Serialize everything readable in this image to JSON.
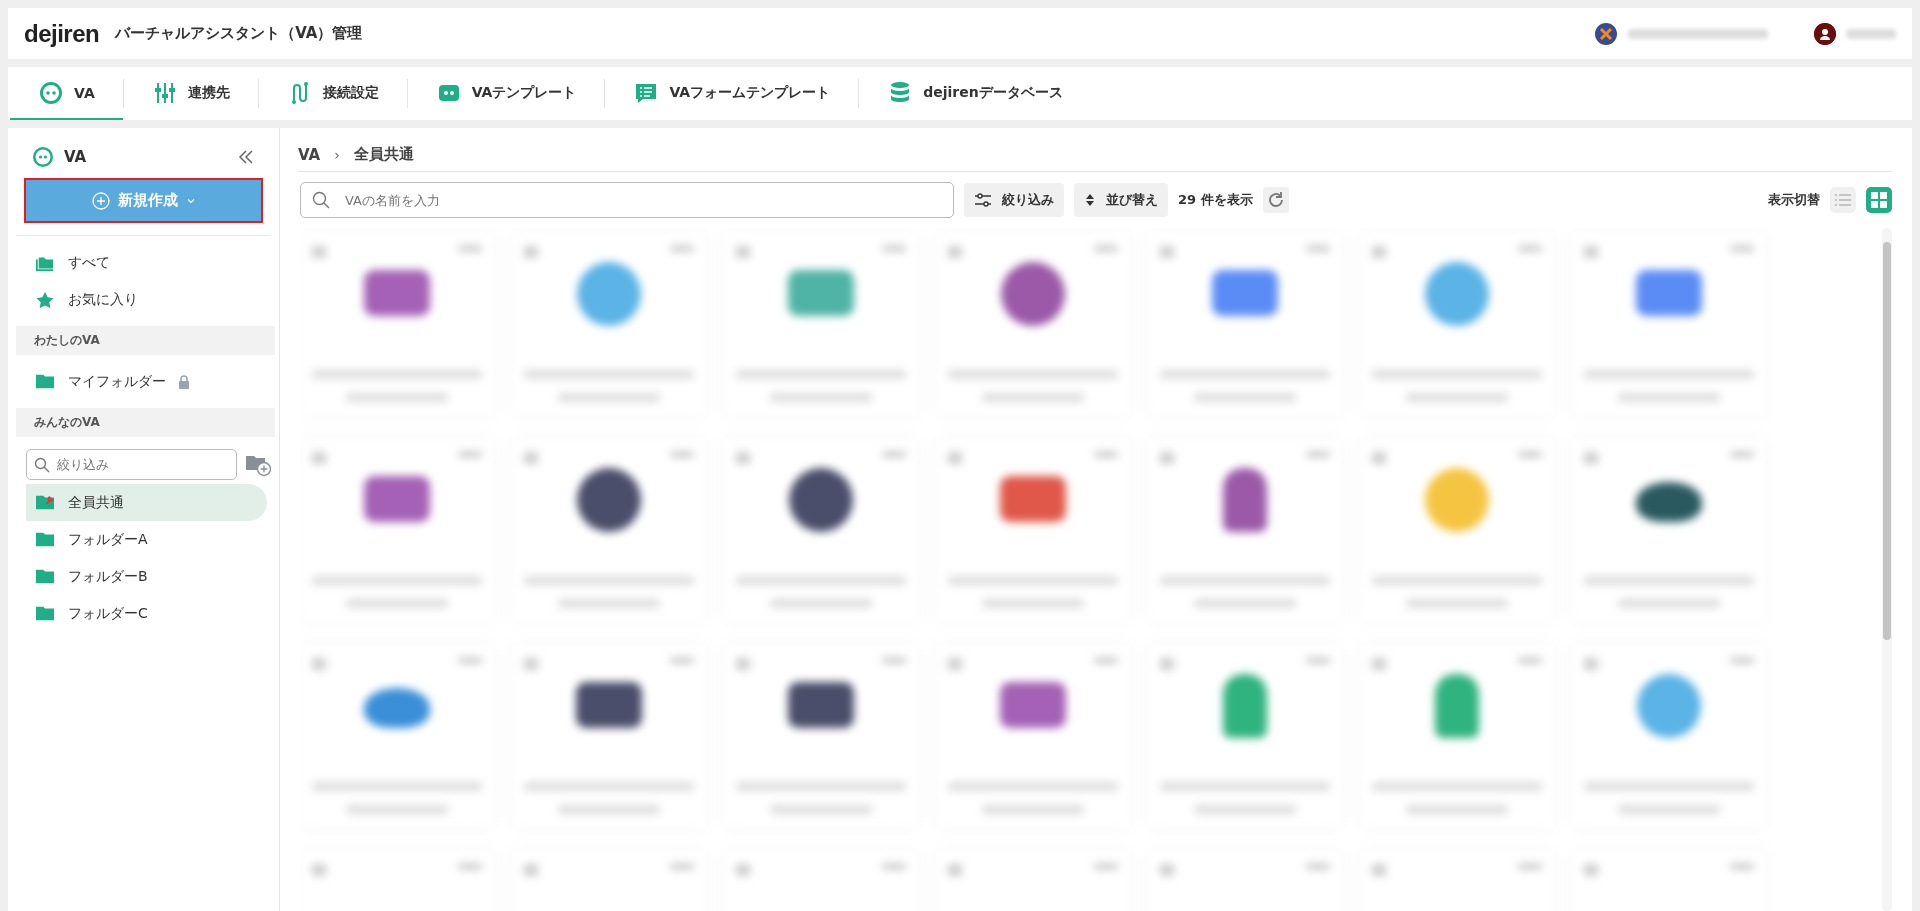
{
  "header": {
    "logo": "dejiren",
    "title": "バーチャルアシスタント（VA）管理"
  },
  "tabs": [
    {
      "label": "VA",
      "kind": "va",
      "selected": true
    },
    {
      "label": "連携先",
      "kind": "sliders",
      "selected": false
    },
    {
      "label": "接続設定",
      "kind": "connect",
      "selected": false
    },
    {
      "label": "VAテンプレート",
      "kind": "template",
      "selected": false
    },
    {
      "label": "VAフォームテンプレート",
      "kind": "form",
      "selected": false
    },
    {
      "label": "dejirenデータベース",
      "kind": "db",
      "selected": false
    }
  ],
  "sidebar": {
    "title": "VA",
    "new_button": "新規作成",
    "top_items": [
      {
        "label": "すべて",
        "kind": "folders",
        "selected": false
      },
      {
        "label": "お気に入り",
        "kind": "star",
        "selected": false
      }
    ],
    "my_section": "わたしのVA",
    "my_items": [
      {
        "label": "マイフォルダー",
        "kind": "folder",
        "locked": true,
        "selected": false
      }
    ],
    "shared_section": "みんなのVA",
    "filter": {
      "placeholder": "絞り込み"
    },
    "shared_items": [
      {
        "label": "全員共通",
        "kind": "pinned",
        "selected": true
      },
      {
        "label": "フォルダーA",
        "kind": "folder",
        "selected": false
      },
      {
        "label": "フォルダーB",
        "kind": "folder",
        "selected": false
      },
      {
        "label": "フォルダーC",
        "kind": "folder",
        "selected": false
      }
    ]
  },
  "breadcrumb": {
    "items": [
      "VA",
      "全員共通"
    ],
    "separator": "›"
  },
  "toolbar": {
    "search": {
      "placeholder": "VAの名前を入力"
    },
    "filter_button": "絞り込み",
    "sort_button": "並び替え",
    "count": "29 件を表示",
    "view_label": "表示切替",
    "views": [
      {
        "kind": "list",
        "selected": false
      },
      {
        "kind": "grid",
        "selected": true
      }
    ]
  },
  "cards": [
    {
      "kind": "square",
      "color": "#a561b5"
    },
    {
      "kind": "circle",
      "color": "#5bb3e6"
    },
    {
      "kind": "square",
      "color": "#4fb3a5"
    },
    {
      "kind": "circle",
      "color": "#9b59a8"
    },
    {
      "kind": "square",
      "color": "#5b8cf5"
    },
    {
      "kind": "circle",
      "color": "#5bb3e6"
    },
    {
      "kind": "square",
      "color": "#5b8cf5"
    },
    {
      "kind": "square",
      "color": "#a561b5"
    },
    {
      "kind": "circle",
      "color": "#4a4e6a"
    },
    {
      "kind": "circle",
      "color": "#4a4e6a"
    },
    {
      "kind": "square",
      "color": "#e0584a"
    },
    {
      "kind": "robot",
      "color": "#9b59a8"
    },
    {
      "kind": "circle",
      "color": "#f5c542"
    },
    {
      "kind": "whale",
      "color": "#2a5a60"
    },
    {
      "kind": "whale",
      "color": "#3a8fd8"
    },
    {
      "kind": "square",
      "color": "#4a4e6a"
    },
    {
      "kind": "square",
      "color": "#4a4e6a"
    },
    {
      "kind": "square",
      "color": "#a561b5"
    },
    {
      "kind": "robot",
      "color": "#2fb37f"
    },
    {
      "kind": "robot",
      "color": "#2fb37f"
    },
    {
      "kind": "circle",
      "color": "#5bb3e6"
    },
    {
      "kind": "cut"
    },
    {
      "kind": "cut"
    },
    {
      "kind": "cut"
    },
    {
      "kind": "cut"
    },
    {
      "kind": "cut"
    },
    {
      "kind": "cut"
    },
    {
      "kind": "cut"
    }
  ]
}
